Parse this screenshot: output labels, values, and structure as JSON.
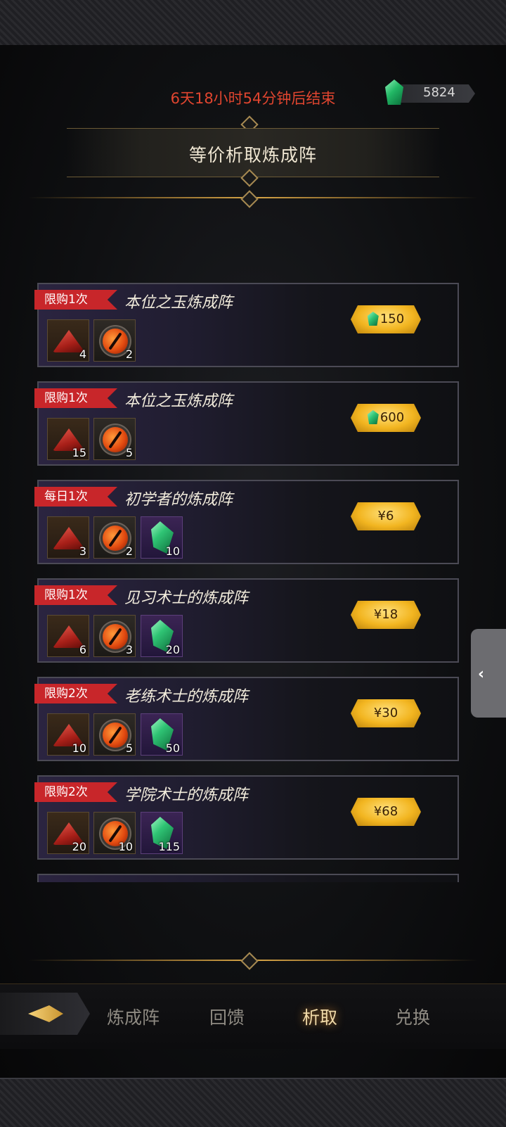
{
  "header": {
    "countdown": "6天18小时54分钟后结束",
    "currency_amount": "5824",
    "title": "等价析取炼成阵"
  },
  "offers": [
    {
      "tag": "限购1次",
      "title": "本位之玉炼成阵",
      "items": [
        {
          "icon": "red-pile-icon",
          "count": "4"
        },
        {
          "icon": "eye-orb-icon",
          "count": "2"
        }
      ],
      "price": "150",
      "price_type": "gem"
    },
    {
      "tag": "限购1次",
      "title": "本位之玉炼成阵",
      "items": [
        {
          "icon": "red-pile-icon",
          "count": "15"
        },
        {
          "icon": "eye-orb-icon",
          "count": "5"
        }
      ],
      "price": "600",
      "price_type": "gem"
    },
    {
      "tag": "每日1次",
      "title": "初学者的炼成阵",
      "items": [
        {
          "icon": "red-pile-icon",
          "count": "3"
        },
        {
          "icon": "eye-orb-icon",
          "count": "2"
        },
        {
          "icon": "green-crystal-icon",
          "count": "10"
        }
      ],
      "price": "¥6",
      "price_type": "cash"
    },
    {
      "tag": "限购1次",
      "title": "见习术士的炼成阵",
      "items": [
        {
          "icon": "red-pile-icon",
          "count": "6"
        },
        {
          "icon": "eye-orb-icon",
          "count": "3"
        },
        {
          "icon": "green-crystal-icon",
          "count": "20"
        }
      ],
      "price": "¥18",
      "price_type": "cash"
    },
    {
      "tag": "限购2次",
      "title": "老练术士的炼成阵",
      "items": [
        {
          "icon": "red-pile-icon",
          "count": "10"
        },
        {
          "icon": "eye-orb-icon",
          "count": "5"
        },
        {
          "icon": "green-crystal-icon",
          "count": "50"
        }
      ],
      "price": "¥30",
      "price_type": "cash"
    },
    {
      "tag": "限购2次",
      "title": "学院术士的炼成阵",
      "items": [
        {
          "icon": "red-pile-icon",
          "count": "20"
        },
        {
          "icon": "eye-orb-icon",
          "count": "10"
        },
        {
          "icon": "green-crystal-icon",
          "count": "115"
        }
      ],
      "price": "¥68",
      "price_type": "cash"
    }
  ],
  "nav": {
    "items": [
      "炼成阵",
      "回馈",
      "析取",
      "兑换"
    ],
    "active": "析取"
  },
  "colors": {
    "countdown": "#e0452f",
    "tag": "#c8262a",
    "price_button": "#f2b520",
    "nav_active": "#f0d9a8"
  }
}
